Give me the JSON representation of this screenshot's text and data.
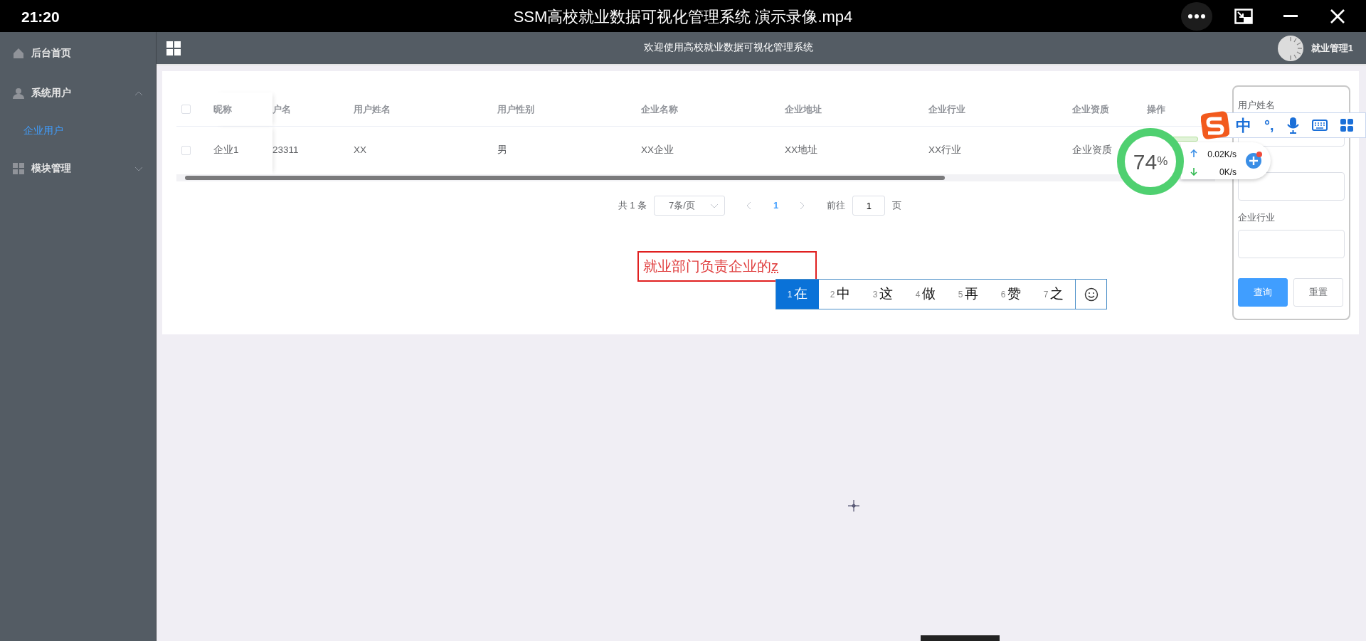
{
  "player": {
    "time": "21:20",
    "title": "SSM高校就业数据可视化管理系统 演示录像.mp4"
  },
  "sidebar": {
    "items": [
      {
        "label": "后台首页",
        "selected": false
      },
      {
        "label": "系统用户",
        "selected": false,
        "expanded": true,
        "children": [
          {
            "label": "企业用户",
            "selected": true
          }
        ]
      },
      {
        "label": "模块管理",
        "selected": false,
        "expanded": false
      }
    ]
  },
  "header": {
    "title": "欢迎使用高校就业数据可视化管理系统",
    "user": "就业管理1"
  },
  "table": {
    "select_all_checked": false,
    "columns": [
      "昵称",
      "户名",
      "用户姓名",
      "用户性别",
      "企业名称",
      "企业地址",
      "企业行业",
      "企业资质",
      "操作"
    ],
    "rows": [
      {
        "checked": false,
        "cells": [
          "企业1",
          "23311",
          "XX",
          "男",
          "XX企业",
          "XX地址",
          "XX行业",
          "企业资质"
        ]
      }
    ]
  },
  "pagination": {
    "total": "共 1 条",
    "page_size": "7条/页",
    "pages": [
      {
        "label": "1",
        "selected": true
      }
    ],
    "goto_label": "前往",
    "goto_value": "1",
    "goto_suffix": "页"
  },
  "search_panel": {
    "fields": [
      {
        "kind": "labeled",
        "label": "用户姓名"
      },
      {
        "kind": "covered"
      },
      {
        "kind": "labeled",
        "label": "企业行业"
      }
    ],
    "buttons": [
      {
        "label": "查询",
        "kind": "primary"
      },
      {
        "label": "重置",
        "kind": "default"
      }
    ]
  },
  "ime": {
    "composition": "就业部门负责企业的",
    "pending": "z",
    "candidates": [
      {
        "index": "1",
        "text": "在",
        "selected": true
      },
      {
        "index": "2",
        "text": "中",
        "selected": false
      },
      {
        "index": "3",
        "text": "这",
        "selected": false
      },
      {
        "index": "4",
        "text": "做",
        "selected": false
      },
      {
        "index": "5",
        "text": "再",
        "selected": false
      },
      {
        "index": "6",
        "text": "赞",
        "selected": false
      },
      {
        "index": "7",
        "text": "之",
        "selected": false
      }
    ]
  },
  "ime_toolbar": {
    "mode": "中",
    "punctuation": "°,"
  },
  "net_widget": {
    "load": "74",
    "unit": "%",
    "upload": "0.02K/s",
    "download": "0K/s"
  }
}
